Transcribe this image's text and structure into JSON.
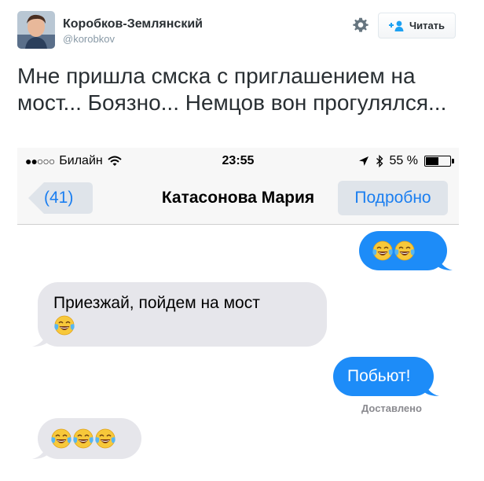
{
  "tweet": {
    "author_name": "Коробков-Землянский",
    "author_handle": "@korobkov",
    "follow_label": "Читать",
    "text": "Мне пришла смска с приглашением на мост... Боязно... Немцов вон прогулялся..."
  },
  "phone": {
    "status": {
      "signal": "●●○○○",
      "carrier": "Билайн",
      "time": "23:55",
      "battery": "55 %",
      "battery_level_percent": 55
    },
    "nav": {
      "back_count": "(41)",
      "title": "Катасонова Мария",
      "details": "Подробно"
    },
    "messages": [
      {
        "direction": "out",
        "text": "",
        "emoji_count": 2
      },
      {
        "direction": "in",
        "text": "Приезжай, пойдем на мост",
        "emoji_count": 1
      },
      {
        "direction": "out",
        "text": "Побьют!",
        "emoji_count": 0
      },
      {
        "direction": "in",
        "text": "",
        "emoji_count": 3
      }
    ],
    "delivered_label": "Доставлено"
  },
  "colors": {
    "imessage_blue": "#1d8cf8",
    "incoming_gray": "#e6e6eb",
    "ios_link_blue": "#1a7ef0",
    "twitter_text": "#292f33",
    "twitter_muted": "#8899a6"
  },
  "icons": [
    "avatar",
    "gear-icon",
    "follow-person-icon",
    "wifi-icon",
    "location-arrow-icon",
    "bluetooth-icon",
    "battery-icon",
    "back-chevron-icon",
    "crying-laughing-emoji"
  ]
}
